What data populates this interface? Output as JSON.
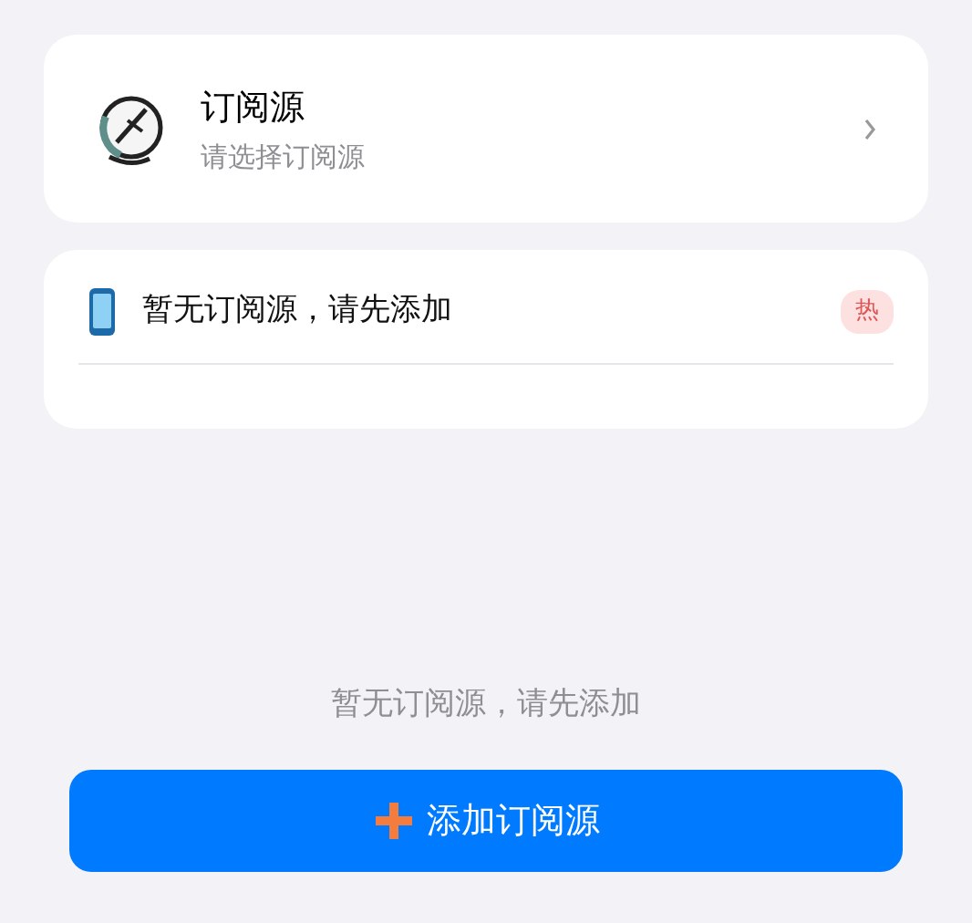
{
  "source_picker": {
    "title": "订阅源",
    "subtitle": "请选择订阅源"
  },
  "feed_list": {
    "items": [
      {
        "title": "暂无订阅源，请先添加",
        "badge": "热"
      }
    ]
  },
  "empty_message": "暂无订阅源，请先添加",
  "add_button": {
    "label": "添加订阅源"
  }
}
